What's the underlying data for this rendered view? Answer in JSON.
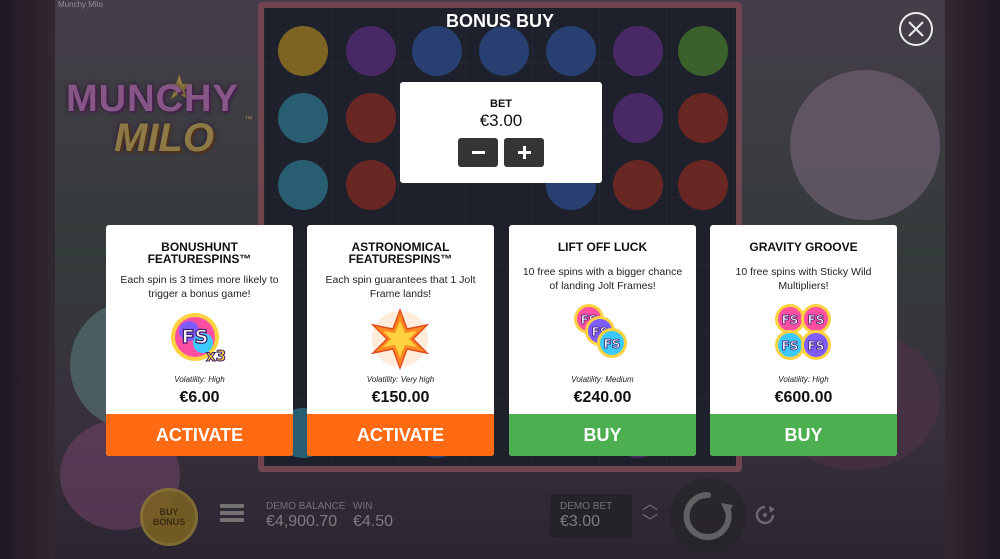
{
  "window": {
    "title": "Munchy Milo"
  },
  "game": {
    "logo_line1": "MUNCHY",
    "logo_line2": "MILO",
    "logo_tm": "™"
  },
  "overlay": {
    "title": "BONUS BUY",
    "close_icon": "close-icon"
  },
  "bet": {
    "label": "BET",
    "amount": "€3.00",
    "decrease_icon": "minus-icon",
    "increase_icon": "plus-icon"
  },
  "offers": [
    {
      "title_line1": "BONUSHUNT",
      "title_line2": "FEATURESPINS™",
      "description": "Each spin is 3 times more likely to trigger a bonus game!",
      "volatility": "Volatility: High",
      "price": "€6.00",
      "button": "ACTIVATE",
      "button_color": "#ff6a13",
      "icon": "fs-x3-icon"
    },
    {
      "title_line1": "ASTRONOMICAL",
      "title_line2": "FEATURESPINS™",
      "description": "Each spin guarantees that 1 Jolt Frame lands!",
      "volatility": "Volatility: Very high",
      "price": "€150.00",
      "button": "ACTIVATE",
      "button_color": "#ff6a13",
      "icon": "jolt-star-icon"
    },
    {
      "title_line1": "LIFT OFF LUCK",
      "title_line2": "",
      "description": "10 free spins with a bigger chance of landing Jolt Frames!",
      "volatility": "Volatility: Medium",
      "price": "€240.00",
      "button": "BUY",
      "button_color": "#4caf50",
      "icon": "fs-stack-3-icon"
    },
    {
      "title_line1": "GRAVITY GROOVE",
      "title_line2": "",
      "description": "10 free spins with Sticky Wild Multipliers!",
      "volatility": "Volatility: High",
      "price": "€600.00",
      "button": "BUY",
      "button_color": "#4caf50",
      "icon": "fs-stack-4-icon"
    }
  ],
  "hud": {
    "buy_bonus": "BUY BONUS",
    "balance_label": "DEMO BALANCE",
    "balance_value": "€4,900.70",
    "win_label": "WIN",
    "win_value": "€4.50",
    "bet_label": "DEMO BET",
    "bet_value": "€3.00",
    "menu_icon": "hamburger-menu-icon",
    "spin_icon": "spin-icon",
    "autoplay_icon": "autoplay-icon"
  },
  "colors": {
    "activate": "#ff6a13",
    "buy": "#4caf50",
    "panel": "#ffffff",
    "stepper": "#353535"
  }
}
